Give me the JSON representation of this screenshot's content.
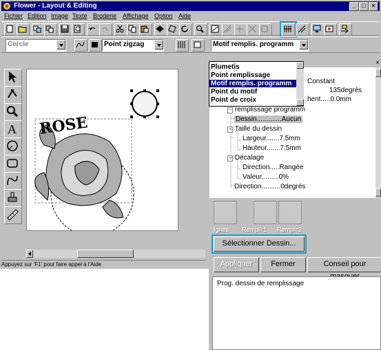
{
  "window": {
    "title": "Flower - Layout & Editing"
  },
  "menu": [
    "Fichier",
    "Edition",
    "Image",
    "Texte",
    "Broderie",
    "Affichage",
    "Option",
    "Aide"
  ],
  "toolbar2": {
    "shape_select": "Cercle",
    "stitch_select": "Point zigzag",
    "fill_select": "Motif remplis. programm"
  },
  "canvas": {
    "text": "ROSE"
  },
  "status": "Appuyez sur 'F1' pour faire appel à l'Aide",
  "dropdown": {
    "options": [
      "Plumetis",
      "Point remplissage",
      "Motif remplis. programm",
      "Point du motif",
      "Point de croix"
    ],
    "selected_index": 2
  },
  "tree": {
    "rows": [
      {
        "label": "Constant"
      },
      {
        "label": "135degrés"
      },
      {
        "label": "hent.....0.0mm"
      },
      {
        "label": "remplissage programm"
      },
      {
        "label": "Dessin.............Aucun"
      },
      {
        "label": "Taille du dessin"
      },
      {
        "label": "Largeur.......7.5mm"
      },
      {
        "label": "Hauteur.......7.5mm"
      },
      {
        "label": "Décalage"
      },
      {
        "label": "Direction.....Rangée"
      },
      {
        "label": "Valeur.........0%"
      },
      {
        "label": "Direction..........0degrés"
      }
    ]
  },
  "thumbs": [
    "Ignes",
    "Remplir1",
    "Remplir2"
  ],
  "buttons": {
    "select_pattern": "Sélectionner Dessin...",
    "apply": "Appliquer",
    "close": "Fermer",
    "hide_tip": "Conseil pour masquer"
  },
  "help_text": "Prog. dessin de remplissage"
}
